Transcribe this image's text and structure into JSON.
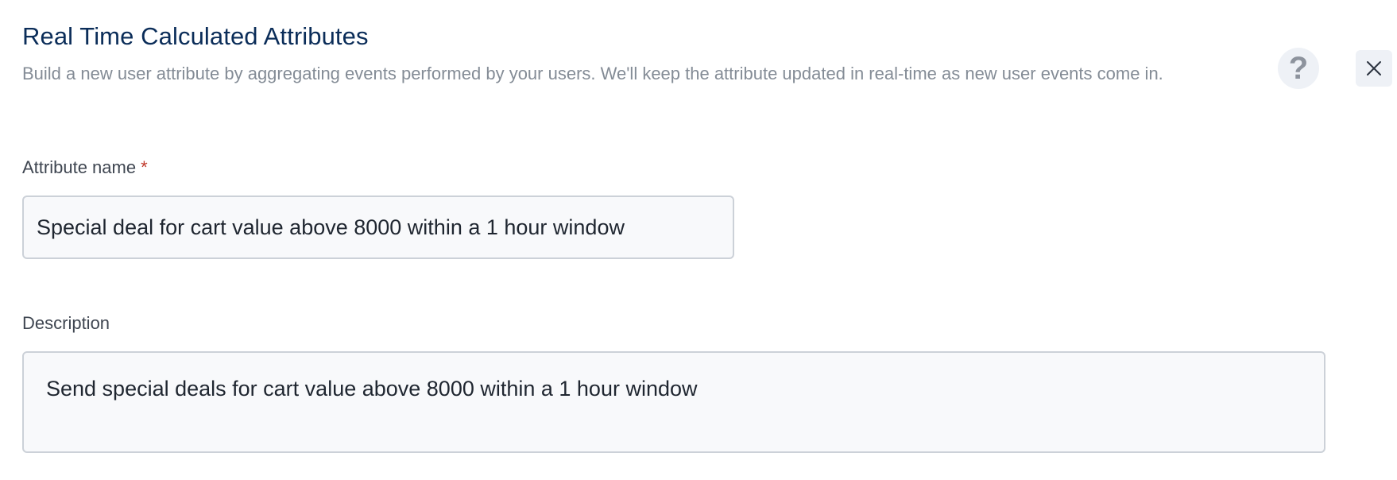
{
  "header": {
    "title": "Real Time Calculated Attributes",
    "subtitle": "Build a new user attribute by aggregating events performed by your users. We'll keep the attribute updated in real-time as new user events come in.",
    "help_glyph": "?",
    "help_icon": "question-mark-icon",
    "close_icon": "close-x-icon"
  },
  "form": {
    "attribute_name": {
      "label": "Attribute name",
      "required_marker": "*",
      "value": "Special deal for cart value above 8000 within a 1 hour window"
    },
    "description": {
      "label": "Description",
      "value": "Send special deals for cart value above 8000 within a 1 hour window"
    }
  },
  "colors": {
    "title": "#0b2d59",
    "subtitle": "#848c96",
    "required": "#c0392b",
    "input_border": "#ccd1d8",
    "input_bg": "#f8f9fb",
    "button_bg": "#eef1f6"
  }
}
